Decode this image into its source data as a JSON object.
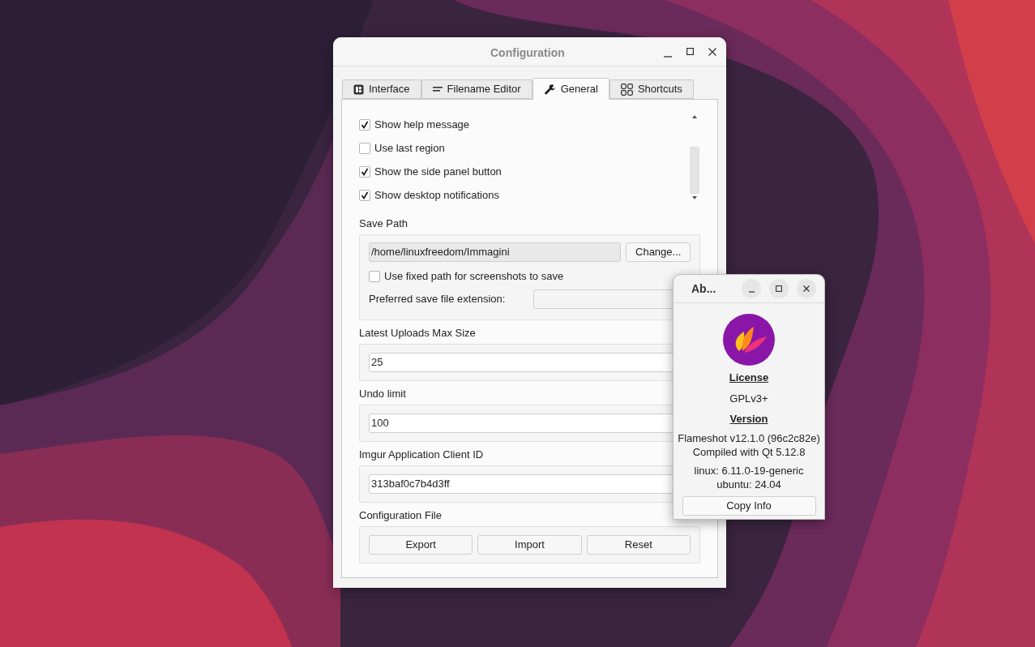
{
  "config_window": {
    "title": "Configuration",
    "tabs": [
      {
        "label": "Interface",
        "selected": false
      },
      {
        "label": "Filename Editor",
        "selected": false
      },
      {
        "label": "General",
        "selected": true
      },
      {
        "label": "Shortcuts",
        "selected": false
      }
    ],
    "checkboxes": [
      {
        "label": "Show help message",
        "checked": true
      },
      {
        "label": "Use last region",
        "checked": false
      },
      {
        "label": "Show the side panel button",
        "checked": true
      },
      {
        "label": "Show desktop notifications",
        "checked": true
      }
    ],
    "save_path": {
      "label": "Save Path",
      "path": "/home/linuxfreedom/Immagini",
      "change_button": "Change...",
      "fixed_path": {
        "label": "Use fixed path for screenshots to save",
        "checked": false
      },
      "extension_label": "Preferred save file extension:"
    },
    "fields": [
      {
        "label": "Latest Uploads Max Size",
        "value": "25"
      },
      {
        "label": "Undo limit",
        "value": "100"
      },
      {
        "label": "Imgur Application Client ID",
        "value": "313baf0c7b4d3ff"
      }
    ],
    "config_file": {
      "label": "Configuration File",
      "buttons": [
        "Export",
        "Import",
        "Reset"
      ]
    }
  },
  "about_window": {
    "title": "Ab...",
    "license_heading": "License",
    "license": "GPLv3+",
    "version_heading": "Version",
    "version_lines": [
      "Flameshot v12.1.0 (96c2c82e)",
      "Compiled with Qt 5.12.8"
    ],
    "system_lines": [
      "linux: 6.11.0-19-generic",
      "ubuntu: 24.04"
    ],
    "button": "Copy Info"
  }
}
